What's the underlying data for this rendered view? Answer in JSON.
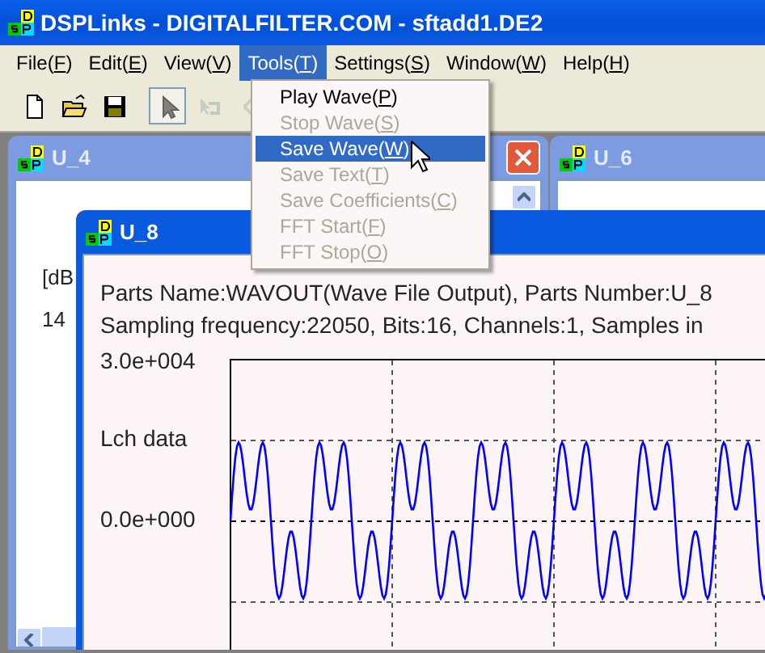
{
  "window": {
    "title": "DSPLinks - DIGITALFILTER.COM - sftadd1.DE2"
  },
  "menu_bar": [
    {
      "label": "File(F)",
      "selected": false
    },
    {
      "label": "Edit(E)",
      "selected": false
    },
    {
      "label": "View(V)",
      "selected": false
    },
    {
      "label": "Tools(T)",
      "selected": true
    },
    {
      "label": "Settings(S)",
      "selected": false
    },
    {
      "label": "Window(W)",
      "selected": false
    },
    {
      "label": "Help(H)",
      "selected": false
    }
  ],
  "open_menu": {
    "items": [
      {
        "label": "Play Wave(P)",
        "disabled": false,
        "selected": false
      },
      {
        "label": "Stop Wave(S)",
        "disabled": true,
        "selected": false
      },
      {
        "label": "Save Wave(W)",
        "disabled": false,
        "selected": true
      },
      {
        "label": "Save Text(T)",
        "disabled": true,
        "selected": false
      },
      {
        "label": "Save Coefficients(C)",
        "disabled": true,
        "selected": false
      },
      {
        "label": "FFT Start(F)",
        "disabled": true,
        "selected": false
      },
      {
        "label": "FFT Stop(O)",
        "disabled": true,
        "selected": false
      }
    ]
  },
  "toolbar": [
    {
      "kind": "new",
      "pressed": false,
      "disabled": false
    },
    {
      "kind": "open",
      "pressed": false,
      "disabled": false
    },
    {
      "kind": "save",
      "pressed": false,
      "disabled": false
    },
    {
      "kind": "pointer",
      "pressed": true,
      "disabled": false
    },
    {
      "kind": "connect",
      "pressed": false,
      "disabled": true
    },
    {
      "kind": "tool",
      "pressed": false,
      "disabled": true
    }
  ],
  "child_windows": [
    {
      "title": "U_4",
      "active": false,
      "lines": [
        "[dB",
        "14"
      ]
    },
    {
      "title": "U_6",
      "active": false
    },
    {
      "title": "U_8",
      "active": true,
      "info_lines": [
        "Parts Name:WAVOUT(Wave File Output), Parts Number:U_8",
        "Sampling frequency:22050, Bits:16, Channels:1, Samples in"
      ],
      "plot": {
        "y_max_label": "3.0e+004",
        "channel_label": "Lch data",
        "y_zero_label": "0.0e+000"
      }
    }
  ]
}
